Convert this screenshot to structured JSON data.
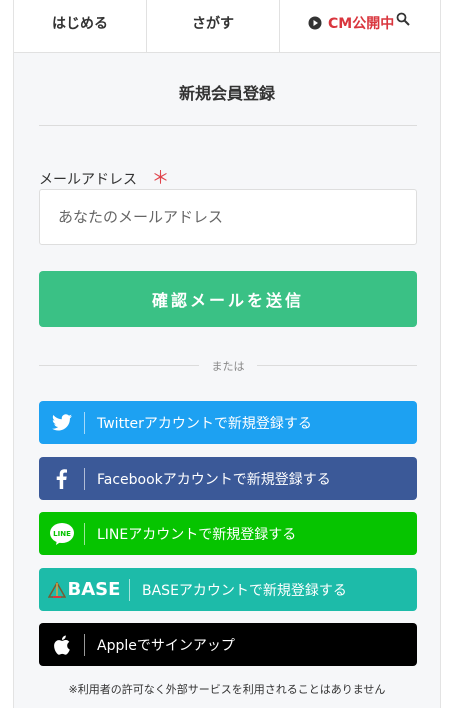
{
  "tabs": {
    "start": "はじめる",
    "search": "さがす",
    "cm": "CM公開中"
  },
  "page": {
    "title": "新規会員登録"
  },
  "form": {
    "email_label": "メールアドレス",
    "required_mark": "＊",
    "email_placeholder": "あなたのメールアドレス",
    "email_value": "",
    "confirm_button": "確認メールを送信"
  },
  "divider": {
    "or_text": "または"
  },
  "social": {
    "twitter": "Twitterアカウントで新規登録する",
    "facebook": "Facebookアカウントで新規登録する",
    "line": "LINEアカウントで新規登録する",
    "base_logo": "BASE",
    "base": "BASEアカウントで新規登録する",
    "apple": "Appleでサインアップ",
    "line_icon_text": "LINE"
  },
  "footer": {
    "note": "※利用者の許可なく外部サービスを利用されることはありません"
  },
  "colors": {
    "confirm": "#3ac185",
    "twitter": "#1da1f2",
    "facebook": "#3b5998",
    "line": "#06c400",
    "base": "#1dbba9",
    "apple": "#000000",
    "required": "#e0434b",
    "cm_tab": "#d9363e"
  },
  "icons": {
    "play": "play-icon",
    "search": "search-icon",
    "twitter": "twitter-icon",
    "facebook": "facebook-icon",
    "line": "line-icon",
    "base": "base-logo",
    "apple": "apple-icon"
  }
}
